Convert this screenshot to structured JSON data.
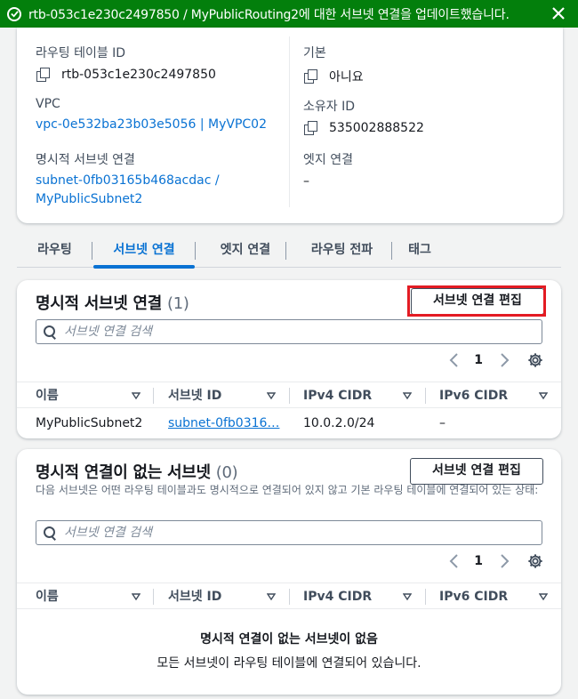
{
  "flash": {
    "message": "rtb-053c1e230c2497850 / MyPublicRouting2에 대한 서브넷 연결을 업데이트했습니다.",
    "type": "success",
    "color": "#037f0c"
  },
  "details": {
    "route_table_id_label": "라우팅 테이블 ID",
    "route_table_id": "rtb-053c1e230c2497850",
    "vpc_label": "VPC",
    "vpc_value": "vpc-0e532ba23b03e5056 | MyVPC02",
    "explicit_label": "명시적 서브넷 연결",
    "explicit_value_line1": "subnet-0fb03165b468acdac /",
    "explicit_value_line2": "MyPublicSubnet2",
    "main_label": "기본",
    "main_value": "아니요",
    "owner_label": "소유자 ID",
    "owner_value": "535002888522",
    "edge_label": "엣지 연결",
    "edge_value": "–"
  },
  "tabs": [
    {
      "label": "라우팅",
      "active": false
    },
    {
      "label": "서브넷 연결",
      "active": true
    },
    {
      "label": "엣지 연결",
      "active": false
    },
    {
      "label": "라우팅 전파",
      "active": false
    },
    {
      "label": "태그",
      "active": false
    }
  ],
  "explicit_panel": {
    "title": "명시적 서브넷 연결",
    "count": "(1)",
    "edit_button": "서브넷 연결 편집",
    "search_placeholder": "서브넷 연결 검색",
    "page": "1",
    "columns": [
      "이름",
      "서브넷 ID",
      "IPv4 CIDR",
      "IPv6 CIDR"
    ],
    "rows": [
      {
        "name": "MyPublicSubnet2",
        "subnet_id": "subnet-0fb0316…",
        "ipv4": "10.0.2.0/24",
        "ipv6": "–"
      }
    ]
  },
  "without_panel": {
    "title": "명시적 연결이 없는 서브넷",
    "count": "(0)",
    "edit_button": "서브넷 연결 편집",
    "description": "다음 서브넷은 어떤 라우팅 테이블과도 명시적으로 연결되어 있지 않고 기본 라우팅 테이블에 연결되어 있는 상태:",
    "search_placeholder": "서브넷 연결 검색",
    "page": "1",
    "columns": [
      "이름",
      "서브넷 ID",
      "IPv4 CIDR",
      "IPv6 CIDR"
    ],
    "empty_title": "명시적 연결이 없는 서브넷이 없음",
    "empty_subtitle": "모든 서브넷이 라우팅 테이블에 연결되어 있습니다."
  },
  "colors": {
    "link": "#0972d3",
    "highlight": "#e31b23"
  },
  "icons": [
    "check-circle-icon",
    "close-icon",
    "copy-icon",
    "search-icon",
    "chevron-left-icon",
    "chevron-right-icon",
    "gear-icon",
    "sort-down-icon"
  ]
}
